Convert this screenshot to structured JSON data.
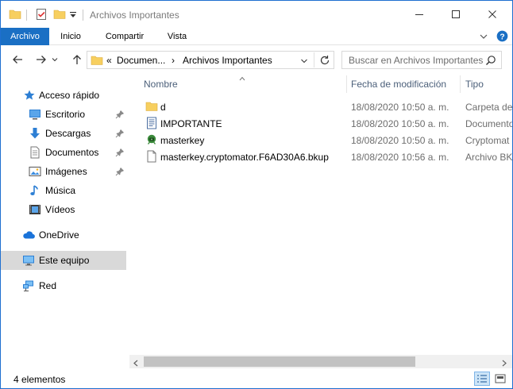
{
  "window": {
    "title": "Archivos Importantes"
  },
  "ribbon": {
    "tabs": [
      {
        "label": "Archivo"
      },
      {
        "label": "Inicio"
      },
      {
        "label": "Compartir"
      },
      {
        "label": "Vista"
      }
    ]
  },
  "address": {
    "overflow": "«",
    "crumbs": [
      "Documen...",
      "Archivos Importantes"
    ],
    "separator": "›"
  },
  "search": {
    "placeholder": "Buscar en Archivos Importantes"
  },
  "sidebar": {
    "items": [
      {
        "label": "Acceso rápido",
        "icon": "star-icon"
      },
      {
        "label": "Escritorio",
        "icon": "desktop-icon",
        "pinned": true
      },
      {
        "label": "Descargas",
        "icon": "download-icon",
        "pinned": true
      },
      {
        "label": "Documentos",
        "icon": "documents-icon",
        "pinned": true
      },
      {
        "label": "Imágenes",
        "icon": "pictures-icon",
        "pinned": true
      },
      {
        "label": "Música",
        "icon": "music-icon"
      },
      {
        "label": "Vídeos",
        "icon": "videos-icon"
      },
      {
        "label": "OneDrive",
        "icon": "cloud-icon"
      },
      {
        "label": "Este equipo",
        "icon": "computer-icon",
        "selected": true
      },
      {
        "label": "Red",
        "icon": "network-icon"
      }
    ]
  },
  "columns": {
    "name": "Nombre",
    "date": "Fecha de modificación",
    "type": "Tipo"
  },
  "files": [
    {
      "name": "d",
      "date": "18/08/2020 10:50 a. m.",
      "type": "Carpeta de",
      "icon": "folder-icon"
    },
    {
      "name": "IMPORTANTE",
      "date": "18/08/2020 10:50 a. m.",
      "type": "Documento",
      "icon": "text-file-icon"
    },
    {
      "name": "masterkey",
      "date": "18/08/2020 10:50 a. m.",
      "type": "Cryptomat",
      "icon": "cryptomator-icon"
    },
    {
      "name": "masterkey.cryptomator.F6AD30A6.bkup",
      "date": "18/08/2020 10:56 a. m.",
      "type": "Archivo BK",
      "icon": "blank-file-icon"
    }
  ],
  "status": {
    "count": "4 elementos"
  },
  "colors": {
    "accent": "#1a6fc4",
    "folder": "#f7cf5f",
    "selection": "#d9d9d9"
  }
}
